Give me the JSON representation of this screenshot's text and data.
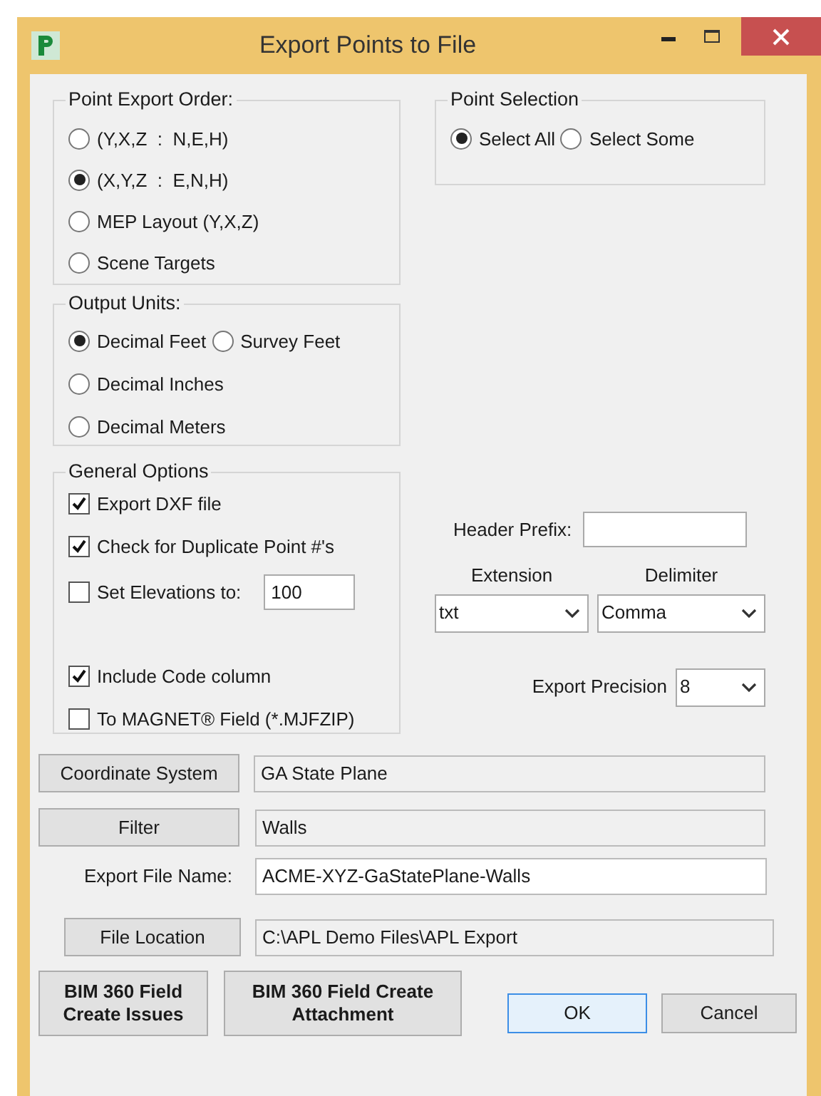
{
  "window": {
    "title": "Export Points to File"
  },
  "point_export_order": {
    "label": "Point Export Order:",
    "rows": [
      [
        {
          "label": "(Y,X,Z  :  N,E,H)",
          "selected": false
        }
      ],
      [
        {
          "label": "(X,Y,Z  :  E,N,H)",
          "selected": true
        }
      ],
      [
        {
          "label": "MEP Layout (Y,X,Z)",
          "selected": false
        }
      ],
      [
        {
          "label": "Scene Targets",
          "selected": false
        }
      ]
    ]
  },
  "point_selection": {
    "label": "Point Selection",
    "rows": [
      [
        {
          "label": "Select All",
          "selected": true
        },
        {
          "label": "Select Some",
          "selected": false
        }
      ]
    ]
  },
  "output_units": {
    "label": "Output Units:",
    "rows": [
      [
        {
          "label": "Decimal Feet",
          "selected": true
        },
        {
          "label": "Survey Feet",
          "selected": false
        }
      ],
      [
        {
          "label": "Decimal Inches",
          "selected": false
        }
      ],
      [
        {
          "label": "Decimal Meters",
          "selected": false
        }
      ]
    ]
  },
  "general_options": {
    "label": "General Options",
    "items": [
      {
        "kind": "checkbox",
        "label": "Export DXF file",
        "checked": true
      },
      {
        "kind": "checkbox",
        "label": "Check for Duplicate Point #'s",
        "checked": true
      },
      {
        "kind": "checkbox_field",
        "label": "Set Elevations to:",
        "checked": false,
        "value": "100"
      },
      {
        "kind": "checkbox",
        "label": "Include Code column",
        "checked": true
      },
      {
        "kind": "checkbox",
        "label": "To MAGNET® Field (*.MJFZIP)",
        "checked": false
      }
    ]
  },
  "header_prefix": {
    "label": "Header Prefix:"
  },
  "extension": {
    "label": "Extension",
    "value": "txt"
  },
  "delimiter": {
    "label": "Delimiter",
    "value": "Comma"
  },
  "export_precision": {
    "label": "Export Precision",
    "value": "8"
  },
  "coordinate_system": {
    "button": "Coordinate System",
    "value": "GA State Plane"
  },
  "filter": {
    "button": "Filter",
    "value": "Walls"
  },
  "export_file_name": {
    "label": "Export File Name:",
    "value": "ACME-XYZ-GaStatePlane-Walls"
  },
  "file_location": {
    "button": "File Location",
    "value": "C:\\APL Demo Files\\APL Export"
  },
  "buttons": [
    {
      "label": "BIM 360 Field Create Issues",
      "default": false
    },
    {
      "label": "BIM 360 Field Create Attachment",
      "default": false
    },
    {
      "label": "OK",
      "default": true
    },
    {
      "label": "Cancel",
      "default": false
    }
  ]
}
